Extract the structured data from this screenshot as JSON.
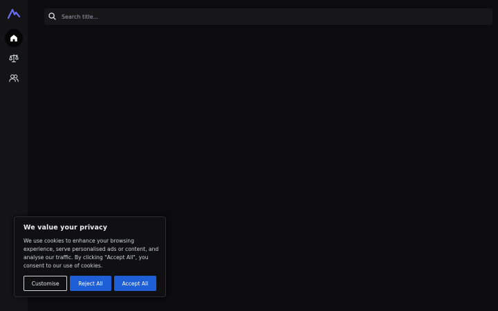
{
  "colors": {
    "background": "#0c0c0e",
    "sidebar": "#141417",
    "search_bg": "#17171a",
    "accent": "#1f5fd6",
    "logo": "#6b6ef5"
  },
  "sidebar": {
    "logo_icon": "brand-logo-icon",
    "items": [
      {
        "icon": "home-icon",
        "active": true
      },
      {
        "icon": "scale-icon",
        "active": false
      },
      {
        "icon": "users-icon",
        "active": false
      }
    ]
  },
  "search": {
    "placeholder": "Search title...",
    "value": "",
    "icon": "search-icon"
  },
  "cookie_banner": {
    "title": "We value your privacy",
    "text": "We use cookies to enhance your browsing experience, serve personalised ads or content, and analyse our traffic. By clicking \"Accept All\", you consent to our use of cookies.",
    "customise_label": "Customise",
    "reject_label": "Reject All",
    "accept_label": "Accept All"
  }
}
